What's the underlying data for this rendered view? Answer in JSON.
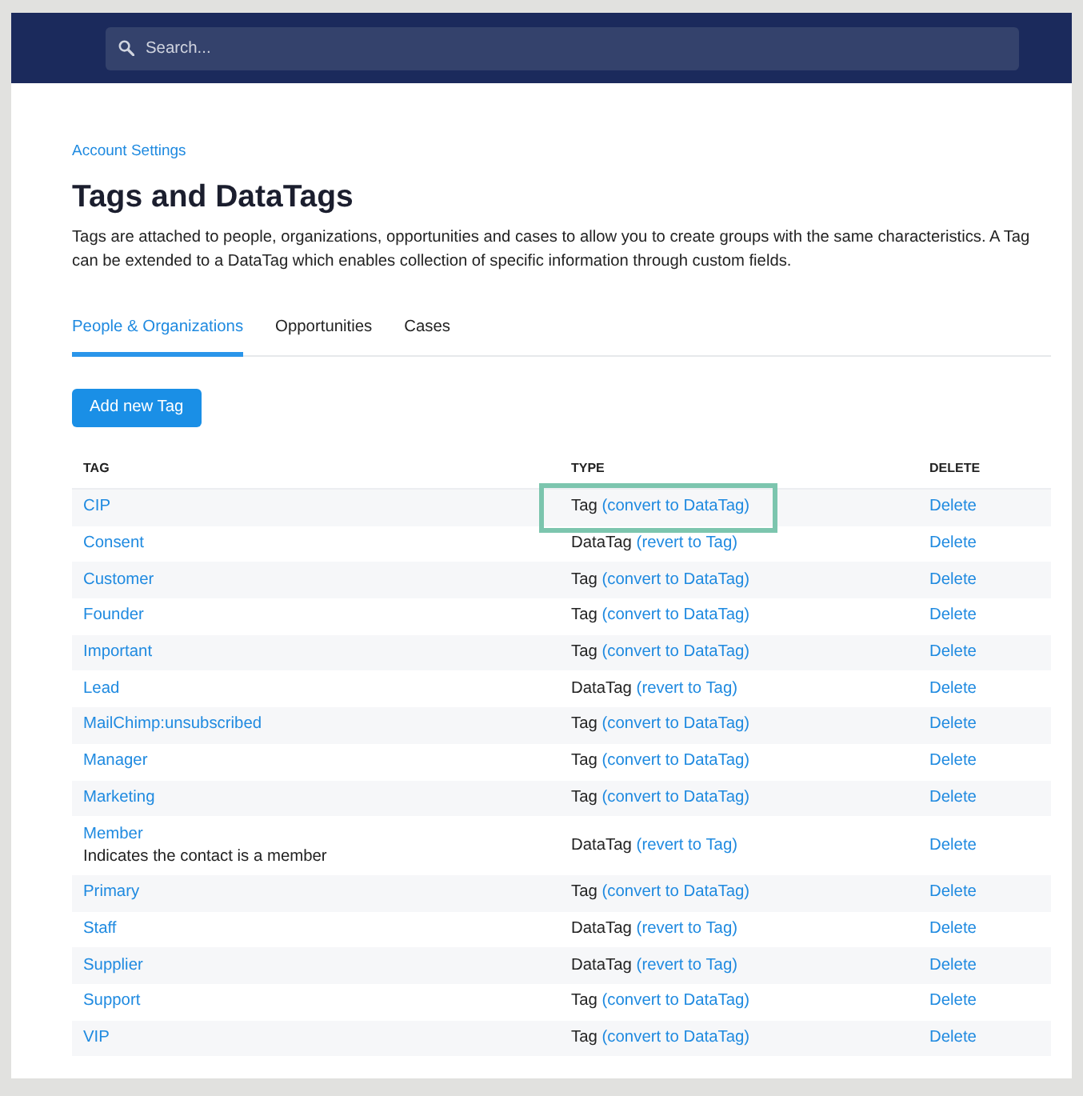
{
  "search": {
    "placeholder": "Search..."
  },
  "breadcrumb": "Account Settings",
  "title": "Tags and DataTags",
  "description": "Tags are attached to people, organizations, opportunities and cases to allow you to create groups with the same characteristics. A Tag can be extended to a DataTag which enables collection of specific information through custom fields.",
  "tabs": [
    {
      "label": "People & Organizations",
      "selected": true
    },
    {
      "label": "Opportunities",
      "selected": false
    },
    {
      "label": "Cases",
      "selected": false
    }
  ],
  "add_button": "Add new Tag",
  "table": {
    "columns": [
      "TAG",
      "TYPE",
      "DELETE"
    ],
    "rows": [
      {
        "tag": "CIP",
        "type": "Tag",
        "action": "(convert to DataTag)",
        "delete": "Delete",
        "highlighted": true
      },
      {
        "tag": "Consent",
        "type": "DataTag",
        "action": "(revert to Tag)",
        "delete": "Delete",
        "highlighted": false
      },
      {
        "tag": "Customer",
        "type": "Tag",
        "action": "(convert to DataTag)",
        "delete": "Delete",
        "highlighted": false
      },
      {
        "tag": "Founder",
        "type": "Tag",
        "action": "(convert to DataTag)",
        "delete": "Delete",
        "highlighted": false
      },
      {
        "tag": "Important",
        "type": "Tag",
        "action": "(convert to DataTag)",
        "delete": "Delete",
        "highlighted": false
      },
      {
        "tag": "Lead",
        "type": "DataTag",
        "action": "(revert to Tag)",
        "delete": "Delete",
        "highlighted": false
      },
      {
        "tag": "MailChimp:unsubscribed",
        "type": "Tag",
        "action": "(convert to DataTag)",
        "delete": "Delete",
        "highlighted": false
      },
      {
        "tag": "Manager",
        "type": "Tag",
        "action": "(convert to DataTag)",
        "delete": "Delete",
        "highlighted": false
      },
      {
        "tag": "Marketing",
        "type": "Tag",
        "action": "(convert to DataTag)",
        "delete": "Delete",
        "highlighted": false
      },
      {
        "tag": "Member",
        "description": "Indicates the contact is a member",
        "type": "DataTag",
        "action": "(revert to Tag)",
        "delete": "Delete",
        "highlighted": false
      },
      {
        "tag": "Primary",
        "type": "Tag",
        "action": "(convert to DataTag)",
        "delete": "Delete",
        "highlighted": false
      },
      {
        "tag": "Staff",
        "type": "DataTag",
        "action": "(revert to Tag)",
        "delete": "Delete",
        "highlighted": false
      },
      {
        "tag": "Supplier",
        "type": "DataTag",
        "action": "(revert to Tag)",
        "delete": "Delete",
        "highlighted": false
      },
      {
        "tag": "Support",
        "type": "Tag",
        "action": "(convert to DataTag)",
        "delete": "Delete",
        "highlighted": false
      },
      {
        "tag": "VIP",
        "type": "Tag",
        "action": "(convert to DataTag)",
        "delete": "Delete",
        "highlighted": false
      }
    ]
  }
}
